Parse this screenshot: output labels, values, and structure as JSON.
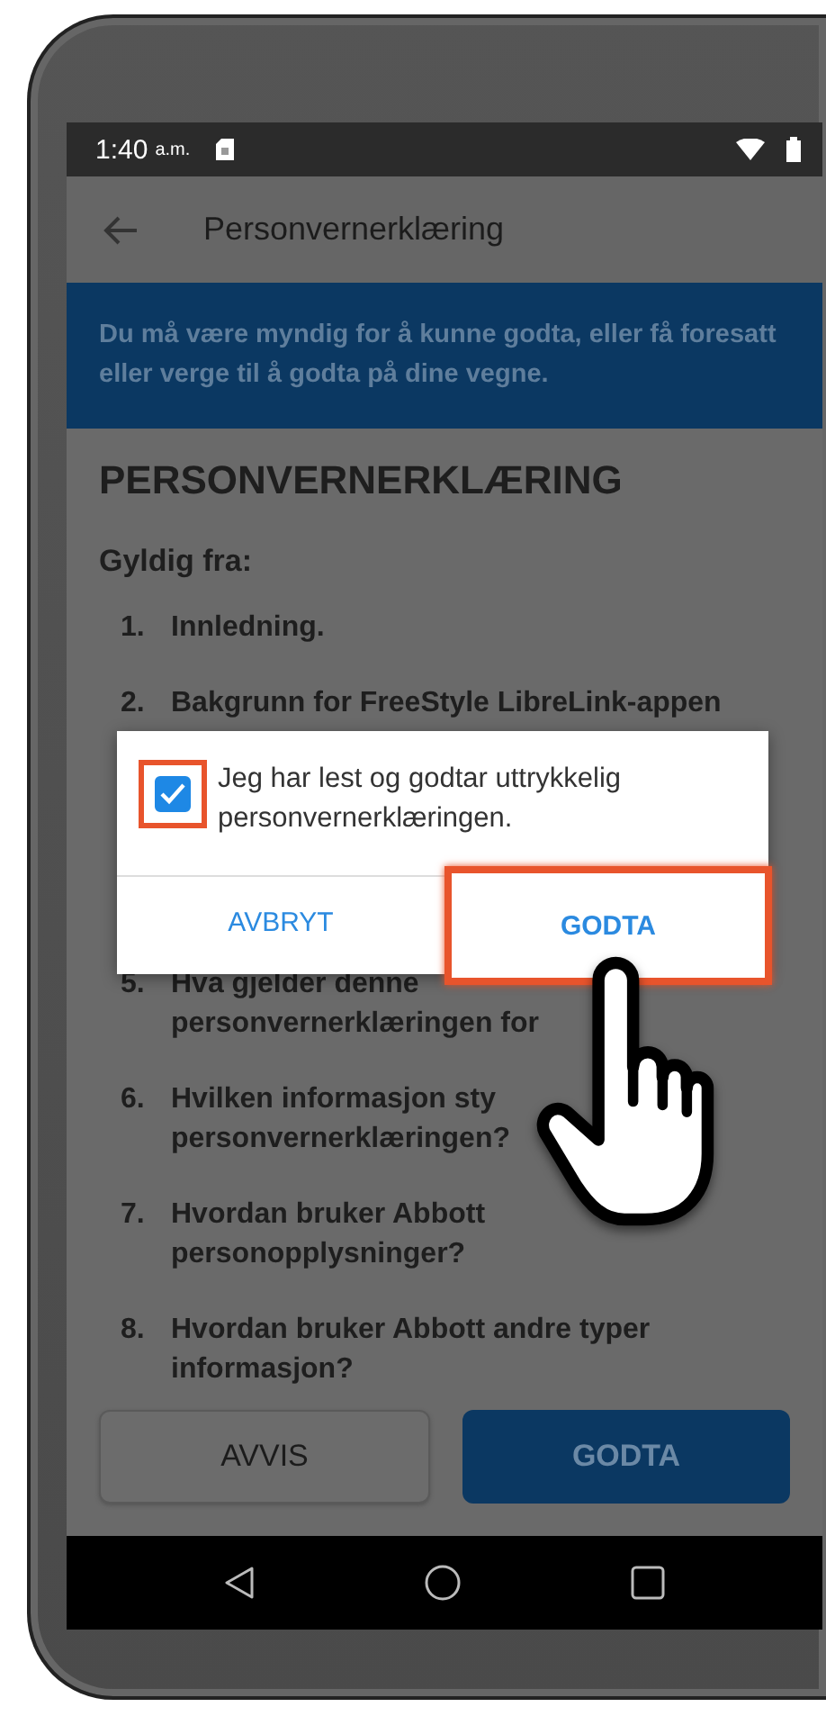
{
  "status_bar": {
    "time": "1:40",
    "period": "a.m."
  },
  "app_bar": {
    "title": "Personvernerklæring"
  },
  "banner": {
    "text": "Du må være myndig for å kunne godta, eller få foresatt eller verge til å godta på dine vegne."
  },
  "document": {
    "heading": "PERSONVERNERKLÆRING",
    "valid_from": "Gyldig fra:",
    "items_before_dialog": [
      {
        "number": "1.",
        "text": "Innledning."
      },
      {
        "number": "2.",
        "text": "Bakgrunn for FreeStyle LibreLink-appen"
      }
    ],
    "items_after_dialog": [
      {
        "number": "5.",
        "text": "Hva gjelder denne personvernerklæringen for"
      },
      {
        "number": "6.",
        "text": "Hvilken informasjon sty personvernerklæringen?"
      },
      {
        "number": "7.",
        "text": "Hvordan bruker Abbott personopplysninger?"
      },
      {
        "number": "8.",
        "text": "Hvordan bruker Abbott andre typer informasjon?"
      }
    ]
  },
  "dialog": {
    "checkbox": {
      "label": "Jeg har lest og godtar uttrykkelig personvernerklæringen.",
      "checked": true,
      "highlighted": true
    },
    "buttons": [
      {
        "label": "AVBRYT",
        "highlighted": false
      },
      {
        "label": "GODTA",
        "highlighted": true
      }
    ]
  },
  "actions": [
    {
      "label": "AVVIS",
      "kind": "secondary"
    },
    {
      "label": "GODTA",
      "kind": "primary"
    }
  ]
}
